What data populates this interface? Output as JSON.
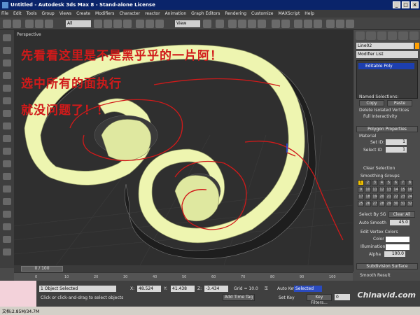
{
  "title": "Untitled - Autodesk 3ds Max 8 - Stand-alone License",
  "title_buttons": [
    "_",
    "□",
    "×"
  ],
  "menu": [
    "File",
    "Edit",
    "Tools",
    "Group",
    "Views",
    "Create",
    "Modifiers",
    "Character",
    "reactor",
    "Animation",
    "Graph Editors",
    "Rendering",
    "Customize",
    "MAXScript",
    "Help"
  ],
  "toolbar": {
    "selection_filter": "All",
    "view_dropdown": "View"
  },
  "viewport": {
    "label": "Perspective",
    "annotations": [
      "先看看这里是不是黑乎乎的一片阿！",
      "选中所有的面执行",
      "就没问题了！！"
    ]
  },
  "command_panel": {
    "object_name": "Line02",
    "modifier_list": "Modifier List",
    "stack_item": "Editable Poly",
    "named_selections": "Named Selections:",
    "copy": "Copy",
    "paste": "Paste",
    "delete_isolated": "Delete Isolated Vertices",
    "full_interactivity": "Full Interactivity",
    "polygon_properties": "Polygon Properties",
    "material": "Material",
    "set_id_label": "Set ID:",
    "set_id_value": "1",
    "select_id_label": "Select ID",
    "select_id_value": "1",
    "clear_selection": "Clear Selection",
    "smoothing_groups": "Smoothing Groups",
    "smoothing_numbers": [
      "1",
      "2",
      "3",
      "4",
      "5",
      "6",
      "7",
      "8",
      "9",
      "10",
      "11",
      "12",
      "13",
      "14",
      "15",
      "16",
      "17",
      "18",
      "19",
      "20",
      "21",
      "22",
      "23",
      "24",
      "25",
      "26",
      "27",
      "28",
      "29",
      "30",
      "31",
      "32"
    ],
    "select_by_sg": "Select By SG",
    "clear_all": "Clear All",
    "auto_smooth": "Auto Smooth",
    "auto_smooth_value": "45.0",
    "edit_vertex_colors": "Edit Vertex Colors",
    "color_label": "Color",
    "illumination_label": "Illumination",
    "alpha_label": "Alpha",
    "alpha_value": "100.0",
    "subdivision_surface": "Subdivision Surface",
    "smooth_result": "Smooth Result"
  },
  "timeline": {
    "frame": "0 / 100"
  },
  "ruler": [
    "0",
    "10",
    "20",
    "30",
    "40",
    "50",
    "60",
    "70",
    "80",
    "90",
    "100"
  ],
  "status": {
    "selected": "1 Object Selected",
    "prompt": "Click or click-and-drag to select objects",
    "x_label": "X:",
    "x": "48.524",
    "y_label": "Y:",
    "y": "41.438",
    "z_label": "Z:",
    "z": "-3.434",
    "grid": "Grid = 10.0",
    "auto_key": "Auto Key",
    "auto_key_mode": "Selected",
    "set_key": "Set Key",
    "key_filters": "Key Filters...",
    "add_time_tag": "Add Time Tag",
    "frame": "0"
  },
  "taskbar": {
    "memory": "文档:2.85M/34.7M"
  },
  "watermark": "Chinavid.com",
  "colors": {
    "annotation": "#d11a1a",
    "mesh_face": "#eef5b0",
    "selection": "#1d3fb0"
  }
}
